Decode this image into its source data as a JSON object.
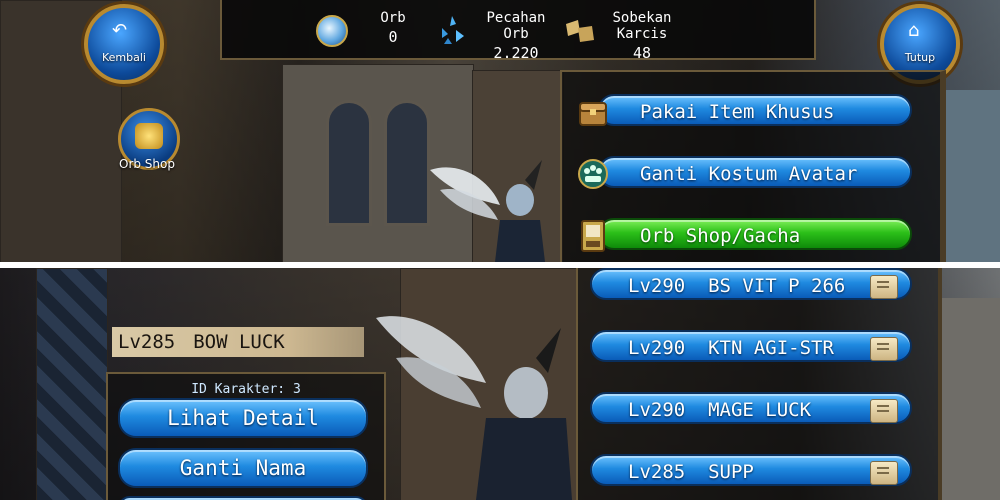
{
  "top_panel": {
    "back_button": {
      "label": "Kembali",
      "icon": "back-arrow-icon"
    },
    "close_button": {
      "label": "Tutup",
      "icon": "home-icon"
    },
    "currency": [
      {
        "label": "Orb",
        "value": "0",
        "icon": "orb-icon"
      },
      {
        "label": "Pecahan Orb",
        "value": "2.220",
        "icon": "orb-shards-icon"
      },
      {
        "label": "Sobekan Karcis",
        "value": "48",
        "icon": "ticket-pieces-icon"
      }
    ],
    "orb_shop_button": {
      "label": "Orb Shop",
      "icon": "coins-icon"
    },
    "menu": [
      {
        "label": "Pakai Item Khusus",
        "icon": "treasure-chest-icon",
        "color": "#1f8ae0"
      },
      {
        "label": "Ganti Kostum Avatar",
        "icon": "costume-icon",
        "color": "#1f8ae0"
      },
      {
        "label": "Orb Shop/Gacha",
        "icon": "gacha-machine-icon",
        "color": "#2cc019"
      }
    ]
  },
  "bottom_panel": {
    "selected_character": {
      "level": "Lv285",
      "name": "BOW LUCK",
      "id_text": "ID Karakter: 3"
    },
    "actions": [
      {
        "label": "Lihat Detail"
      },
      {
        "label": "Ganti Nama"
      }
    ],
    "characters": [
      {
        "level": "Lv290",
        "name": "BS VIT P 266",
        "icon": "scroll-icon"
      },
      {
        "level": "Lv290",
        "name": "KTN AGI-STR",
        "icon": "scroll-icon"
      },
      {
        "level": "Lv290",
        "name": "MAGE LUCK",
        "icon": "scroll-icon"
      },
      {
        "level": "Lv285",
        "name": "SUPP",
        "icon": "scroll-icon"
      }
    ]
  }
}
